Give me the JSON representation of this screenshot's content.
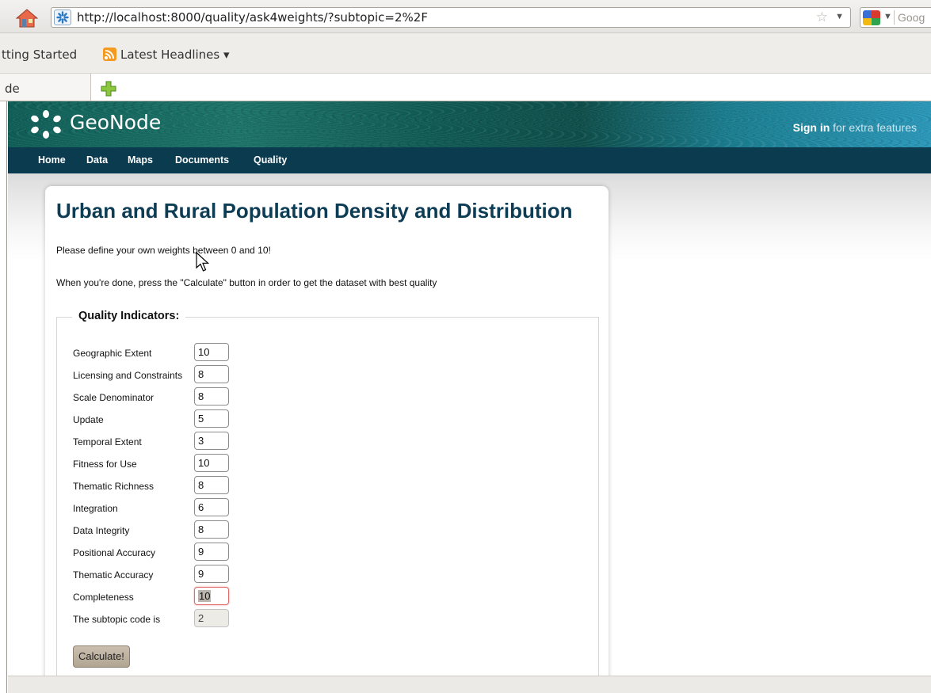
{
  "browser": {
    "url": "http://localhost:8000/quality/ask4weights/?subtopic=2%2F",
    "search_placeholder": "Goog",
    "bookmarks": [
      "tting Started",
      "Latest Headlines ▾"
    ],
    "tab_label": "de"
  },
  "site": {
    "brand": "GeoNode",
    "sign_in_link": "Sign in",
    "sign_in_suffix": " for extra features",
    "nav": [
      "Home",
      "Data",
      "Maps",
      "Documents",
      "Quality"
    ]
  },
  "page": {
    "title": "Urban and Rural Population Density and Distribution",
    "intro_1": "Please define your own weights between 0 and 10!",
    "intro_2": "When you're done, press the \"Calculate\" button in order to get the dataset with best quality",
    "legend": "Quality Indicators:",
    "indicators": [
      {
        "label": "Geographic Extent",
        "value": "10"
      },
      {
        "label": "Licensing and Constraints",
        "value": "8"
      },
      {
        "label": "Scale Denominator",
        "value": "8"
      },
      {
        "label": "Update",
        "value": "5"
      },
      {
        "label": "Temporal Extent",
        "value": "3"
      },
      {
        "label": "Fitness for Use",
        "value": "10"
      },
      {
        "label": "Thematic Richness",
        "value": "8"
      },
      {
        "label": "Integration",
        "value": "6"
      },
      {
        "label": "Data Integrity",
        "value": "8"
      },
      {
        "label": "Positional Accuracy",
        "value": "9"
      },
      {
        "label": "Thematic Accuracy",
        "value": "9"
      },
      {
        "label": "Completeness",
        "value": "10"
      }
    ],
    "subtopic_label": "The subtopic code is",
    "subtopic_value": "2",
    "calculate_label": "Calculate!"
  },
  "colors": {
    "nav_bg": "#0b3b4f",
    "title": "#0d3c55",
    "button": "#b9ad9a"
  }
}
